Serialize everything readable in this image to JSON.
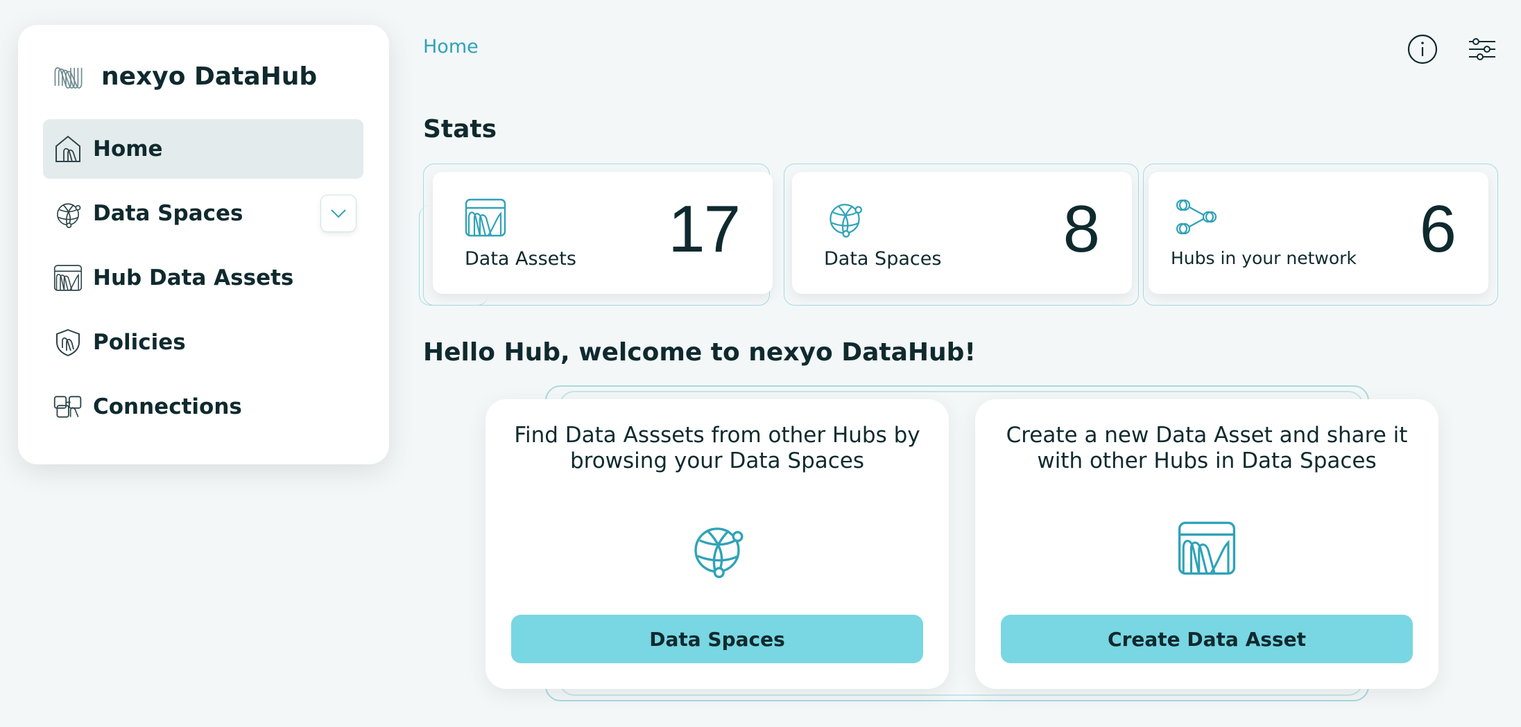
{
  "app": {
    "name": "nexyo DataHub"
  },
  "sidebar": {
    "items": [
      {
        "label": "Home",
        "icon": "home-icon",
        "active": true
      },
      {
        "label": "Data Spaces",
        "icon": "globe-icon",
        "expandable": true
      },
      {
        "label": "Hub Data Assets",
        "icon": "data-asset-icon"
      },
      {
        "label": "Policies",
        "icon": "shield-icon"
      },
      {
        "label": "Connections",
        "icon": "connections-icon"
      }
    ]
  },
  "header": {
    "breadcrumb": "Home",
    "icons": [
      "info-icon",
      "settings-sliders-icon"
    ]
  },
  "stats": {
    "title": "Stats",
    "cards": [
      {
        "label": "Data Assets",
        "value": "17",
        "icon": "data-asset-icon"
      },
      {
        "label": "Data Spaces",
        "value": "8",
        "icon": "globe-icon"
      },
      {
        "label": "Hubs in your network",
        "value": "6",
        "icon": "network-icon"
      }
    ]
  },
  "welcome": {
    "title": "Hello Hub, welcome to nexyo DataHub!",
    "cards": [
      {
        "text": "Find Data Asssets from other Hubs by browsing your Data Spaces",
        "button": "Data Spaces",
        "icon": "globe-icon"
      },
      {
        "text": "Create a new Data Asset and share it with other Hubs in Data Spaces",
        "button": "Create Data Asset",
        "icon": "data-asset-icon"
      }
    ]
  },
  "colors": {
    "accent": "#2fa3b7",
    "button": "#79d6e3",
    "text": "#0f2a2e",
    "background": "#f3f7f8"
  }
}
